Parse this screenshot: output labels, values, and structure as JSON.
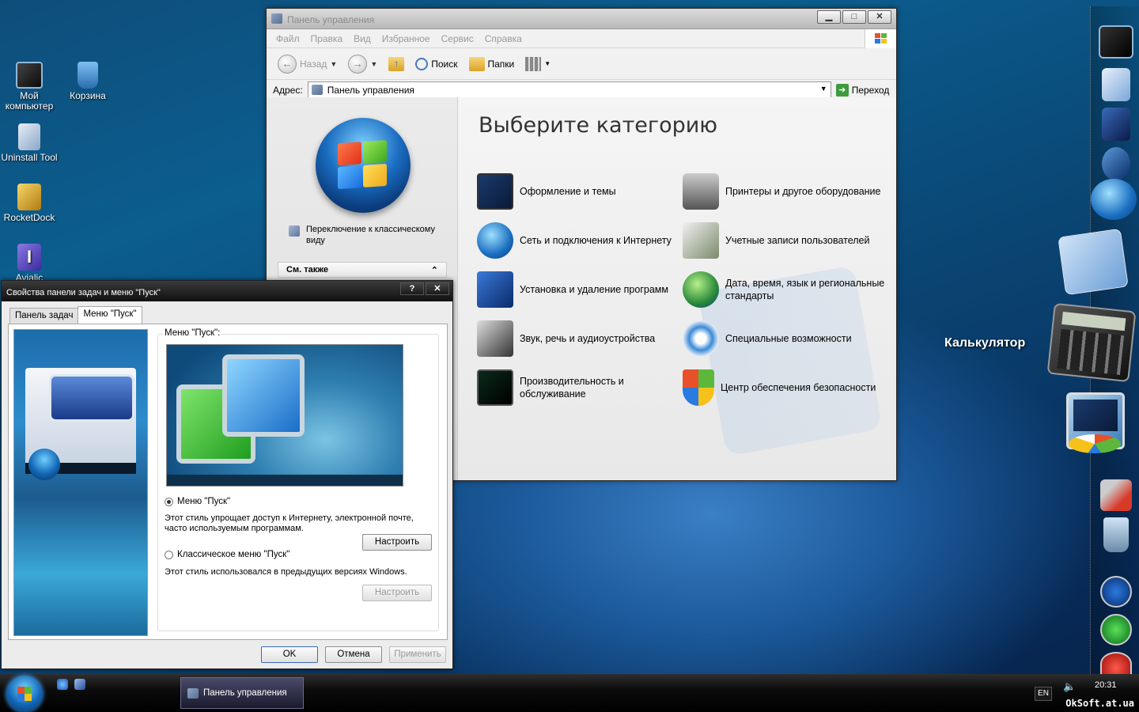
{
  "desktop": {
    "icons": [
      {
        "label": "Мой компьютер",
        "icon": "my-computer-icon"
      },
      {
        "label": "Корзина",
        "icon": "recycle-bin-icon"
      },
      {
        "label": "Uninstall Tool",
        "icon": "uninstall-tool-icon"
      },
      {
        "label": "RocketDock",
        "icon": "rocketdock-icon"
      },
      {
        "label": "Avialic",
        "icon": "avialic-icon"
      }
    ]
  },
  "control_panel": {
    "title": "Панель управления",
    "menu": [
      "Файл",
      "Правка",
      "Вид",
      "Избранное",
      "Сервис",
      "Справка"
    ],
    "toolbar": {
      "back": "Назад",
      "search": "Поиск",
      "folders": "Папки"
    },
    "address": {
      "label": "Адрес:",
      "value": "Панель управления",
      "go": "Переход"
    },
    "left": {
      "switch_view": "Переключение к классическому виду",
      "see_also": "См. также"
    },
    "heading": "Выберите категорию",
    "categories": [
      {
        "label": "Оформление и темы",
        "icon": "appearance-themes-icon"
      },
      {
        "label": "Принтеры и другое оборудование",
        "icon": "printers-icon"
      },
      {
        "label": "Сеть и подключения к Интернету",
        "icon": "network-icon"
      },
      {
        "label": "Учетные записи пользователей",
        "icon": "user-accounts-icon"
      },
      {
        "label": "Установка и удаление программ",
        "icon": "add-remove-programs-icon"
      },
      {
        "label": "Дата, время, язык и региональные стандарты",
        "icon": "date-time-language-icon"
      },
      {
        "label": "Звук, речь и аудиоустройства",
        "icon": "sound-icon"
      },
      {
        "label": "Специальные возможности",
        "icon": "accessibility-icon"
      },
      {
        "label": "Производительность и обслуживание",
        "icon": "performance-icon"
      },
      {
        "label": "Центр обеспечения безопасности",
        "icon": "security-center-icon"
      }
    ]
  },
  "dialog": {
    "title": "Свойства панели задач и меню \"Пуск\"",
    "help": "?",
    "close": "✕",
    "tabs": [
      "Панель задач",
      "Меню \"Пуск\""
    ],
    "group_label": "Меню \"Пуск\":",
    "option1": {
      "label": "Меню \"Пуск\"",
      "desc": "Этот стиль упрощает доступ к Интернету, электронной почте, часто используемым программам.",
      "button": "Настроить",
      "selected": true
    },
    "option2": {
      "label": "Классическое меню \"Пуск\"",
      "desc": "Этот стиль использовался в предыдущих версиях Windows.",
      "button": "Настроить",
      "selected": false
    },
    "buttons": {
      "ok": "OK",
      "cancel": "Отмена",
      "apply": "Применить"
    }
  },
  "taskbar": {
    "active_window": "Панель управления",
    "lang": "EN",
    "time": "20:31"
  },
  "dock": {
    "label": "Калькулятор"
  },
  "watermark": "OkSoft.at.ua"
}
